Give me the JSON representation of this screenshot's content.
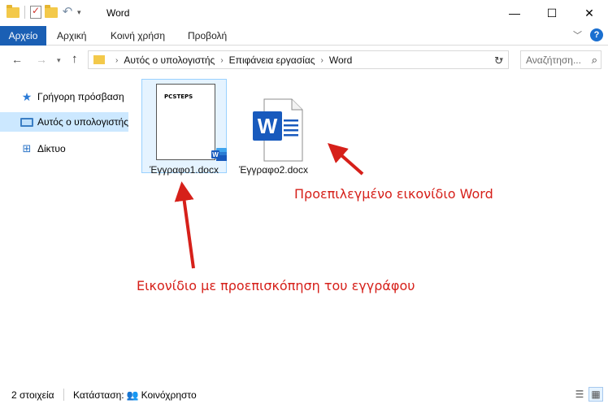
{
  "titlebar": {
    "title": "Word",
    "minimize_glyph": "—",
    "maximize_glyph": "☐",
    "close_glyph": "✕"
  },
  "ribbon": {
    "tabs": [
      "Αρχείο",
      "Αρχική",
      "Κοινή χρήση",
      "Προβολή"
    ]
  },
  "address": {
    "crumbs": [
      "Αυτός ο υπολογιστής",
      "Επιφάνεια εργασίας",
      "Word"
    ]
  },
  "search": {
    "placeholder": "Αναζήτηση..."
  },
  "sidebar": {
    "items": [
      {
        "label": "Γρήγορη πρόσβαση",
        "icon": "quick-access-star-icon"
      },
      {
        "label": "Αυτός ο υπολογιστής",
        "icon": "computer-icon"
      },
      {
        "label": "Δίκτυο",
        "icon": "network-icon"
      }
    ]
  },
  "files": [
    {
      "name": "Έγγραφο1.docx",
      "thumb_text": "PCSTEPS"
    },
    {
      "name": "Έγγραφο2.docx",
      "icon": "word-document-icon"
    }
  ],
  "annotations": {
    "default_icon": "Προεπιλεγμένο εικονίδιο Word",
    "preview_icon": "Εικονίδιο με προεπισκόπηση του εγγράφου"
  },
  "status": {
    "count": "2 στοιχεία",
    "state_label": "Κατάσταση:",
    "state_value": "Κοινόχρηστο"
  },
  "colors": {
    "accent": "#1a5fb4",
    "selection": "#cce8ff",
    "annotation": "#d6201a",
    "word_blue": "#185abd"
  }
}
